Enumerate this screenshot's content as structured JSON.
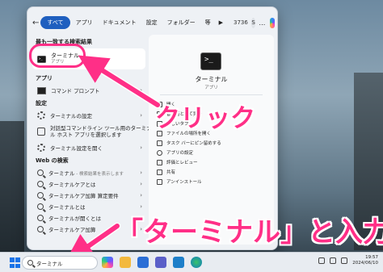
{
  "filter_bar": {
    "back": "←",
    "tabs": [
      "すべて",
      "アプリ",
      "ドキュメント",
      "設定",
      "フォルダー",
      "等"
    ],
    "more": "▶",
    "counter": "3736",
    "avatar_initial": "S",
    "dots": "…"
  },
  "left": {
    "best_match_head": "最も一致する検索結果",
    "best_match_title": "ターミナル",
    "best_match_sub": "アプリ",
    "apps_head": "アプリ",
    "apps": [
      {
        "label": "コマンド プロンプト"
      }
    ],
    "settings_head": "設定",
    "settings": [
      {
        "label": "ターミナルの設定"
      },
      {
        "label": "対話型コマンドライン ツール用のターミナ",
        "label2": "ル ホスト アプリを選択します"
      },
      {
        "label": "ターミナル設定を開く"
      }
    ],
    "web_head": "Web の検索",
    "web": [
      {
        "label": "ターミナル",
        "sub": " - 検索結果を表示します"
      },
      {
        "label": "ターミナルケアとは"
      },
      {
        "label": "ターミナルケア加算 算定要件"
      },
      {
        "label": "ターミナルとは"
      },
      {
        "label": "ターミナルが開くとは"
      },
      {
        "label": "ターミナルケア加算"
      }
    ]
  },
  "detail": {
    "title": "ターミナル",
    "subtitle": "アプリ",
    "actions": [
      "開く",
      "管理者として実行",
      "新しいタブ",
      "ファイルの場所を開く",
      "タスク バーにピン留めする",
      "アプリの設定",
      "評価とレビュー",
      "共有",
      "アンインストール"
    ]
  },
  "overlay": {
    "click_label": "クリック",
    "input_label": "「ターミナル」と入力"
  },
  "taskbar": {
    "search_value": "ターミナル",
    "time": "19:57",
    "date": "2024/06/10"
  },
  "colors": {
    "accent": "#1f5fbf",
    "annotation": "#ff2f87"
  }
}
